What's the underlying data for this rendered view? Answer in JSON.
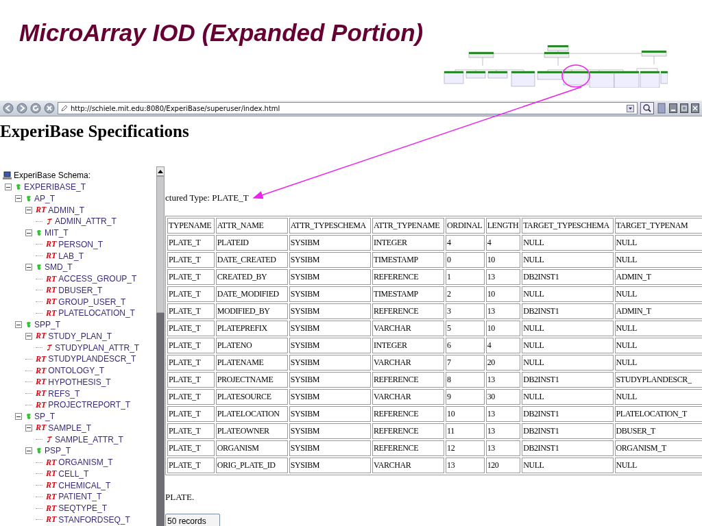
{
  "slide": {
    "title": "MicroArray IOD (Expanded Portion)"
  },
  "browser": {
    "url": "http://schiele.mit.edu:8080/ExperiBase/superuser/index.html"
  },
  "page": {
    "heading": "ExperiBase Specifications"
  },
  "tree": {
    "title": "ExperiBase Schema:",
    "items": [
      {
        "label": "EXPERIBASE_T",
        "kind": "schema",
        "expanded": true,
        "children": [
          {
            "label": "AP_T",
            "kind": "schema",
            "expanded": true,
            "children": [
              {
                "label": "ADMIN_T",
                "kind": "rt",
                "badge": "RT",
                "expanded": true,
                "children": [
                  {
                    "label": "ADMIN_ATTR_T",
                    "kind": "attr"
                  }
                ]
              },
              {
                "label": "MIT_T",
                "kind": "schema",
                "expanded": true,
                "children": [
                  {
                    "label": "PERSON_T",
                    "kind": "rt",
                    "badge": "RT"
                  },
                  {
                    "label": "LAB_T",
                    "kind": "rt",
                    "badge": "RT"
                  }
                ]
              },
              {
                "label": "SMD_T",
                "kind": "schema",
                "expanded": true,
                "children": [
                  {
                    "label": "ACCESS_GROUP_T",
                    "kind": "rt",
                    "badge": "RT"
                  },
                  {
                    "label": "DBUSER_T",
                    "kind": "rt",
                    "badge": "RT"
                  },
                  {
                    "label": "GROUP_USER_T",
                    "kind": "rt",
                    "badge": "RT"
                  },
                  {
                    "label": "PLATELOCATION_T",
                    "kind": "rt",
                    "badge": "RT"
                  }
                ]
              }
            ]
          },
          {
            "label": "SPP_T",
            "kind": "schema",
            "expanded": true,
            "children": [
              {
                "label": "STUDY_PLAN_T",
                "kind": "rt",
                "badge": "RT",
                "expanded": true,
                "children": [
                  {
                    "label": "STUDYPLAN_ATTR_T",
                    "kind": "attr"
                  }
                ]
              },
              {
                "label": "STUDYPLANDESCR_T",
                "kind": "rt",
                "badge": "RT"
              },
              {
                "label": "ONTOLOGY_T",
                "kind": "rt",
                "badge": "RT"
              },
              {
                "label": "HYPOTHESIS_T",
                "kind": "rt",
                "badge": "RT"
              },
              {
                "label": "REFS_T",
                "kind": "rt",
                "badge": "RT"
              },
              {
                "label": "PROJECTREPORT_T",
                "kind": "rt",
                "badge": "RT"
              }
            ]
          },
          {
            "label": "SP_T",
            "kind": "schema",
            "expanded": true,
            "children": [
              {
                "label": "SAMPLE_T",
                "kind": "rt",
                "badge": "RT",
                "expanded": true,
                "children": [
                  {
                    "label": "SAMPLE_ATTR_T",
                    "kind": "attr"
                  }
                ]
              },
              {
                "label": "PSP_T",
                "kind": "schema",
                "expanded": true,
                "children": [
                  {
                    "label": "ORGANISM_T",
                    "kind": "rt",
                    "badge": "RT"
                  },
                  {
                    "label": "CELL_T",
                    "kind": "rt",
                    "badge": "RT"
                  },
                  {
                    "label": "CHEMICAL_T",
                    "kind": "rt",
                    "badge": "RT"
                  },
                  {
                    "label": "PATIENT_T",
                    "kind": "rt",
                    "badge": "RT"
                  },
                  {
                    "label": "SEQTYPE_T",
                    "kind": "rt",
                    "badge": "RT"
                  },
                  {
                    "label": "STANFORDSEQ_T",
                    "kind": "rt",
                    "badge": "RT"
                  }
                ]
              }
            ]
          }
        ]
      }
    ]
  },
  "content": {
    "type_label": "ctured Type: PLATE_T",
    "table": {
      "columns": [
        "TYPENAME",
        "ATTR_NAME",
        "ATTR_TYPESCHEMA",
        "ATTR_TYPENAME",
        "ORDINAL",
        "LENGTH",
        "TARGET_TYPESCHEMA",
        "TARGET_TYPENAM"
      ],
      "rows": [
        [
          "PLATE_T",
          "PLATEID",
          "SYSIBM",
          "INTEGER",
          "4",
          "4",
          "NULL",
          "NULL"
        ],
        [
          "PLATE_T",
          "DATE_CREATED",
          "SYSIBM",
          "TIMESTAMP",
          "0",
          "10",
          "NULL",
          "NULL"
        ],
        [
          "PLATE_T",
          "CREATED_BY",
          "SYSIBM",
          "REFERENCE",
          "1",
          "13",
          "DB2INST1",
          "ADMIN_T"
        ],
        [
          "PLATE_T",
          "DATE_MODIFIED",
          "SYSIBM",
          "TIMESTAMP",
          "2",
          "10",
          "NULL",
          "NULL"
        ],
        [
          "PLATE_T",
          "MODIFIED_BY",
          "SYSIBM",
          "REFERENCE",
          "3",
          "13",
          "DB2INST1",
          "ADMIN_T"
        ],
        [
          "PLATE_T",
          "PLATEPREFIX",
          "SYSIBM",
          "VARCHAR",
          "5",
          "10",
          "NULL",
          "NULL"
        ],
        [
          "PLATE_T",
          "PLATENO",
          "SYSIBM",
          "INTEGER",
          "6",
          "4",
          "NULL",
          "NULL"
        ],
        [
          "PLATE_T",
          "PLATENAME",
          "SYSIBM",
          "VARCHAR",
          "7",
          "20",
          "NULL",
          "NULL"
        ],
        [
          "PLATE_T",
          "PROJECTNAME",
          "SYSIBM",
          "REFERENCE",
          "8",
          "13",
          "DB2INST1",
          "STUDYPLANDESCR_"
        ],
        [
          "PLATE_T",
          "PLATESOURCE",
          "SYSIBM",
          "VARCHAR",
          "9",
          "30",
          "NULL",
          "NULL"
        ],
        [
          "PLATE_T",
          "PLATELOCATION",
          "SYSIBM",
          "REFERENCE",
          "10",
          "13",
          "DB2INST1",
          "PLATELOCATION_T"
        ],
        [
          "PLATE_T",
          "PLATEOWNER",
          "SYSIBM",
          "REFERENCE",
          "11",
          "13",
          "DB2INST1",
          "DBUSER_T"
        ],
        [
          "PLATE_T",
          "ORGANISM",
          "SYSIBM",
          "REFERENCE",
          "12",
          "13",
          "DB2INST1",
          "ORGANISM_T"
        ],
        [
          "PLATE_T",
          "ORIG_PLATE_ID",
          "SYSIBM",
          "VARCHAR",
          "13",
          "120",
          "NULL",
          "NULL"
        ]
      ]
    },
    "footer_text": "PLATE.",
    "records_button": "50 records"
  }
}
